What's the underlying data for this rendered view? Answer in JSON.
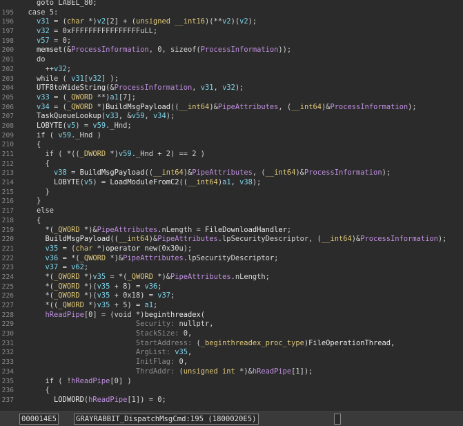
{
  "editor": {
    "lines": [
      {
        "n": "",
        "t": [
          [
            "plain",
            "    goto LABEL_80;"
          ]
        ]
      },
      {
        "n": "195",
        "t": [
          [
            "plain",
            "  case 5:"
          ]
        ]
      },
      {
        "n": "196",
        "t": [
          [
            "var",
            "    v31"
          ],
          [
            "plain",
            " = ("
          ],
          [
            "ty",
            "char"
          ],
          [
            "plain",
            " *)"
          ],
          [
            "var",
            "v2"
          ],
          [
            "plain",
            "[2] + ("
          ],
          [
            "ty",
            "unsigned __int16"
          ],
          [
            "plain",
            ")(**"
          ],
          [
            "var",
            "v2"
          ],
          [
            "plain",
            ")("
          ],
          [
            "var",
            "v2"
          ],
          [
            "plain",
            ");"
          ]
        ]
      },
      {
        "n": "197",
        "t": [
          [
            "var",
            "    v32"
          ],
          [
            "plain",
            " = 0xFFFFFFFFFFFFFFFFuLL;"
          ]
        ]
      },
      {
        "n": "198",
        "t": [
          [
            "var",
            "    v57"
          ],
          [
            "plain",
            " = 0;"
          ]
        ]
      },
      {
        "n": "200",
        "t": [
          [
            "fn",
            "    memset"
          ],
          [
            "plain",
            "(&"
          ],
          [
            "glb",
            "ProcessInformation"
          ],
          [
            "plain",
            ", 0, sizeof("
          ],
          [
            "glb",
            "ProcessInformation"
          ],
          [
            "plain",
            "));"
          ]
        ]
      },
      {
        "n": "201",
        "t": [
          [
            "plain",
            "    do"
          ]
        ]
      },
      {
        "n": "202",
        "t": [
          [
            "plain",
            "      ++"
          ],
          [
            "var",
            "v32"
          ],
          [
            "plain",
            ";"
          ]
        ]
      },
      {
        "n": "203",
        "t": [
          [
            "plain",
            "    while ( "
          ],
          [
            "var",
            "v31"
          ],
          [
            "plain",
            "["
          ],
          [
            "var",
            "v32"
          ],
          [
            "plain",
            "] );"
          ]
        ]
      },
      {
        "n": "204",
        "t": [
          [
            "fn",
            "    UTF8toWideString"
          ],
          [
            "plain",
            "(&"
          ],
          [
            "glb",
            "ProcessInformation"
          ],
          [
            "plain",
            ", "
          ],
          [
            "var",
            "v31"
          ],
          [
            "plain",
            ", "
          ],
          [
            "var",
            "v32"
          ],
          [
            "plain",
            ");"
          ]
        ]
      },
      {
        "n": "205",
        "t": [
          [
            "var",
            "    v33"
          ],
          [
            "plain",
            " = ("
          ],
          [
            "ty",
            "_QWORD"
          ],
          [
            "plain",
            " **)"
          ],
          [
            "var",
            "a1"
          ],
          [
            "plain",
            "[7];"
          ]
        ]
      },
      {
        "n": "206",
        "t": [
          [
            "var",
            "    v34"
          ],
          [
            "plain",
            " = ("
          ],
          [
            "ty",
            "_QWORD"
          ],
          [
            "plain",
            " *)"
          ],
          [
            "fn",
            "BuildMsgPayload"
          ],
          [
            "plain",
            "(("
          ],
          [
            "ty",
            "__int64"
          ],
          [
            "plain",
            ")&"
          ],
          [
            "glb",
            "PipeAttributes"
          ],
          [
            "plain",
            ", ("
          ],
          [
            "ty",
            "__int64"
          ],
          [
            "plain",
            ")&"
          ],
          [
            "glb",
            "ProcessInformation"
          ],
          [
            "plain",
            ");"
          ]
        ]
      },
      {
        "n": "207",
        "t": [
          [
            "fn",
            "    TaskQueueLookup"
          ],
          [
            "plain",
            "("
          ],
          [
            "var",
            "v33"
          ],
          [
            "plain",
            ", &"
          ],
          [
            "var",
            "v59"
          ],
          [
            "plain",
            ", "
          ],
          [
            "var",
            "v34"
          ],
          [
            "plain",
            ");"
          ]
        ]
      },
      {
        "n": "208",
        "t": [
          [
            "fn",
            "    LOBYTE"
          ],
          [
            "plain",
            "("
          ],
          [
            "var",
            "v5"
          ],
          [
            "plain",
            ") = "
          ],
          [
            "var",
            "v59"
          ],
          [
            "plain",
            "._Hnd;"
          ]
        ]
      },
      {
        "n": "209",
        "t": [
          [
            "plain",
            "    if ( "
          ],
          [
            "var",
            "v59"
          ],
          [
            "plain",
            "._Hnd )"
          ]
        ]
      },
      {
        "n": "210",
        "t": [
          [
            "plain",
            "    {"
          ]
        ]
      },
      {
        "n": "211",
        "t": [
          [
            "plain",
            "      if ( *(("
          ],
          [
            "ty",
            "_DWORD"
          ],
          [
            "plain",
            " *)"
          ],
          [
            "var",
            "v59"
          ],
          [
            "plain",
            "._Hnd + 2) == 2 )"
          ]
        ]
      },
      {
        "n": "212",
        "t": [
          [
            "plain",
            "      {"
          ]
        ]
      },
      {
        "n": "213",
        "t": [
          [
            "var",
            "        v38"
          ],
          [
            "plain",
            " = "
          ],
          [
            "fn",
            "BuildMsgPayload"
          ],
          [
            "plain",
            "(("
          ],
          [
            "ty",
            "__int64"
          ],
          [
            "plain",
            ")&"
          ],
          [
            "glb",
            "PipeAttributes"
          ],
          [
            "plain",
            ", ("
          ],
          [
            "ty",
            "__int64"
          ],
          [
            "plain",
            ")&"
          ],
          [
            "glb",
            "ProcessInformation"
          ],
          [
            "plain",
            ");"
          ]
        ]
      },
      {
        "n": "214",
        "t": [
          [
            "fn",
            "        LOBYTE"
          ],
          [
            "plain",
            "("
          ],
          [
            "var",
            "v5"
          ],
          [
            "plain",
            ") = "
          ],
          [
            "fn",
            "LoadModuleFromC2"
          ],
          [
            "plain",
            "(("
          ],
          [
            "ty",
            "__int64"
          ],
          [
            "plain",
            ")"
          ],
          [
            "var",
            "a1"
          ],
          [
            "plain",
            ", "
          ],
          [
            "var",
            "v38"
          ],
          [
            "plain",
            ");"
          ]
        ]
      },
      {
        "n": "215",
        "t": [
          [
            "plain",
            "      }"
          ]
        ]
      },
      {
        "n": "216",
        "t": [
          [
            "plain",
            "    }"
          ]
        ]
      },
      {
        "n": "217",
        "t": [
          [
            "plain",
            "    else"
          ]
        ]
      },
      {
        "n": "218",
        "t": [
          [
            "plain",
            "    {"
          ]
        ]
      },
      {
        "n": "219",
        "t": [
          [
            "plain",
            "      *("
          ],
          [
            "ty",
            "_QWORD"
          ],
          [
            "plain",
            " *)&"
          ],
          [
            "glb",
            "PipeAttributes"
          ],
          [
            "plain",
            ".nLength = "
          ],
          [
            "fn",
            "FileDownloadHandler"
          ],
          [
            "plain",
            ";"
          ]
        ]
      },
      {
        "n": "220",
        "t": [
          [
            "fn",
            "      BuildMsgPayload"
          ],
          [
            "plain",
            "(("
          ],
          [
            "ty",
            "__int64"
          ],
          [
            "plain",
            ")&"
          ],
          [
            "glb",
            "PipeAttributes"
          ],
          [
            "plain",
            ".lpSecurityDescriptor, ("
          ],
          [
            "ty",
            "__int64"
          ],
          [
            "plain",
            ")&"
          ],
          [
            "glb",
            "ProcessInformation"
          ],
          [
            "plain",
            ");"
          ]
        ]
      },
      {
        "n": "221",
        "t": [
          [
            "var",
            "      v35"
          ],
          [
            "plain",
            " = ("
          ],
          [
            "ty",
            "char"
          ],
          [
            "plain",
            " *)"
          ],
          [
            "fn",
            "operator new"
          ],
          [
            "plain",
            "(0x30u);"
          ]
        ]
      },
      {
        "n": "222",
        "t": [
          [
            "var",
            "      v36"
          ],
          [
            "plain",
            " = *("
          ],
          [
            "ty",
            "_QWORD"
          ],
          [
            "plain",
            " *)&"
          ],
          [
            "glb",
            "PipeAttributes"
          ],
          [
            "plain",
            ".lpSecurityDescriptor;"
          ]
        ]
      },
      {
        "n": "223",
        "t": [
          [
            "var",
            "      v37"
          ],
          [
            "plain",
            " = "
          ],
          [
            "var",
            "v62"
          ],
          [
            "plain",
            ";"
          ]
        ]
      },
      {
        "n": "224",
        "t": [
          [
            "plain",
            "      *("
          ],
          [
            "ty",
            "_QWORD"
          ],
          [
            "plain",
            " *)"
          ],
          [
            "var",
            "v35"
          ],
          [
            "plain",
            " = *("
          ],
          [
            "ty",
            "_QWORD"
          ],
          [
            "plain",
            " *)&"
          ],
          [
            "glb",
            "PipeAttributes"
          ],
          [
            "plain",
            ".nLength;"
          ]
        ]
      },
      {
        "n": "225",
        "t": [
          [
            "plain",
            "      *("
          ],
          [
            "ty",
            "_QWORD"
          ],
          [
            "plain",
            " *)("
          ],
          [
            "var",
            "v35"
          ],
          [
            "plain",
            " + 8) = "
          ],
          [
            "var",
            "v36"
          ],
          [
            "plain",
            ";"
          ]
        ]
      },
      {
        "n": "226",
        "t": [
          [
            "plain",
            "      *("
          ],
          [
            "ty",
            "_QWORD"
          ],
          [
            "plain",
            " *)("
          ],
          [
            "var",
            "v35"
          ],
          [
            "plain",
            " + 0x18) = "
          ],
          [
            "var",
            "v37"
          ],
          [
            "plain",
            ";"
          ]
        ]
      },
      {
        "n": "227",
        "t": [
          [
            "plain",
            "      *(("
          ],
          [
            "ty",
            "_QWORD"
          ],
          [
            "plain",
            " *)"
          ],
          [
            "var",
            "v35"
          ],
          [
            "plain",
            " + 5) = "
          ],
          [
            "var",
            "a1"
          ],
          [
            "plain",
            ";"
          ]
        ]
      },
      {
        "n": "228",
        "t": [
          [
            "glb",
            "      hReadPipe"
          ],
          [
            "plain",
            "[0] = (void *)"
          ],
          [
            "fn",
            "beginthreadex"
          ],
          [
            "plain",
            "("
          ]
        ]
      },
      {
        "n": "229",
        "t": [
          [
            "mt",
            "                           Security: "
          ],
          [
            "plain",
            "nullptr,"
          ]
        ]
      },
      {
        "n": "230",
        "t": [
          [
            "mt",
            "                           StackSize: "
          ],
          [
            "plain",
            "0,"
          ]
        ]
      },
      {
        "n": "231",
        "t": [
          [
            "mt",
            "                           StartAddress: "
          ],
          [
            "plain",
            "("
          ],
          [
            "ty",
            "_beginthreadex_proc_type"
          ],
          [
            "plain",
            ")"
          ],
          [
            "fn",
            "FileOperationThread"
          ],
          [
            "plain",
            ","
          ]
        ]
      },
      {
        "n": "232",
        "t": [
          [
            "mt",
            "                           ArgList: "
          ],
          [
            "var",
            "v35"
          ],
          [
            "plain",
            ","
          ]
        ]
      },
      {
        "n": "233",
        "t": [
          [
            "mt",
            "                           InitFlag: "
          ],
          [
            "plain",
            "0,"
          ]
        ]
      },
      {
        "n": "234",
        "t": [
          [
            "mt",
            "                           ThrdAddr: "
          ],
          [
            "plain",
            "("
          ],
          [
            "ty",
            "unsigned int"
          ],
          [
            "plain",
            " *)&"
          ],
          [
            "glb",
            "hReadPipe"
          ],
          [
            "plain",
            "[1]);"
          ]
        ]
      },
      {
        "n": "235",
        "t": [
          [
            "plain",
            "      if ( !"
          ],
          [
            "glb",
            "hReadPipe"
          ],
          [
            "plain",
            "[0] )"
          ]
        ]
      },
      {
        "n": "236",
        "t": [
          [
            "plain",
            "      {"
          ]
        ]
      },
      {
        "n": "237",
        "t": [
          [
            "fn",
            "        LODWORD"
          ],
          [
            "plain",
            "("
          ],
          [
            "glb",
            "hReadPipe"
          ],
          [
            "plain",
            "[1]) = 0;"
          ]
        ]
      }
    ]
  },
  "status": {
    "address": "000014E5",
    "location": "GRAYRABBIT_DispatchMsgCmd:195 (1800020E5)"
  },
  "colors": {
    "background": "#2b2b2b",
    "variable": "#7fd7ee",
    "global": "#c08fe0",
    "type": "#e0c879"
  }
}
